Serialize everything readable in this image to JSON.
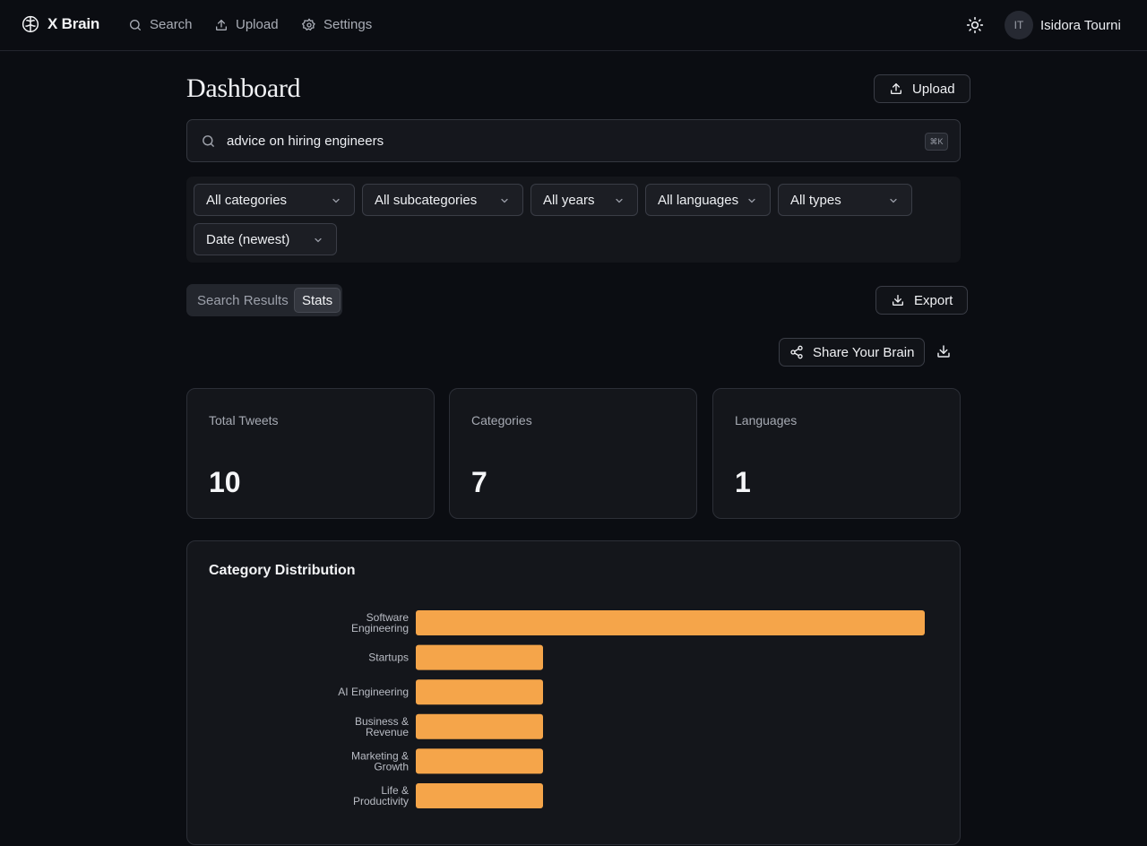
{
  "brand": {
    "name": "X Brain",
    "icon": "brain-icon"
  },
  "nav": {
    "links": [
      {
        "label": "Search",
        "icon": "search-icon"
      },
      {
        "label": "Upload",
        "icon": "upload-icon"
      },
      {
        "label": "Settings",
        "icon": "gear-icon"
      }
    ],
    "theme_icon": "sun-icon",
    "user": {
      "initials": "IT",
      "name": "Isidora Tourni"
    }
  },
  "page": {
    "title": "Dashboard",
    "upload_label": "Upload"
  },
  "search": {
    "value": "advice on hiring engineers",
    "shortcut": "⌘K"
  },
  "filters": {
    "selects": [
      "All categories",
      "All subcategories",
      "All years",
      "All languages",
      "All types",
      "Date (newest)"
    ]
  },
  "view_tabs": {
    "tabs": [
      "Search Results",
      "Stats"
    ],
    "active": "Stats"
  },
  "actions": {
    "export_label": "Export",
    "share_label": "Share Your Brain",
    "download_icon": "download-icon"
  },
  "stats": [
    {
      "label": "Total Tweets",
      "value": "10"
    },
    {
      "label": "Categories",
      "value": "7"
    },
    {
      "label": "Languages",
      "value": "1"
    }
  ],
  "colors": {
    "accent_bar": "#f5a54a",
    "background": "#0b0d12",
    "card": "#14161b"
  },
  "chart_data": {
    "type": "bar",
    "orientation": "horizontal",
    "title": "Category Distribution",
    "categories": [
      [
        "Software",
        "Engineering"
      ],
      [
        "Startups"
      ],
      [
        "AI Engineering"
      ],
      [
        "Business &",
        "Revenue"
      ],
      [
        "Marketing &",
        "Growth"
      ],
      [
        "Life &",
        "Productivity"
      ]
    ],
    "values": [
      4,
      1,
      1,
      1,
      1,
      1
    ],
    "xlim": [
      0,
      4
    ],
    "grid": false,
    "legend": "none"
  }
}
